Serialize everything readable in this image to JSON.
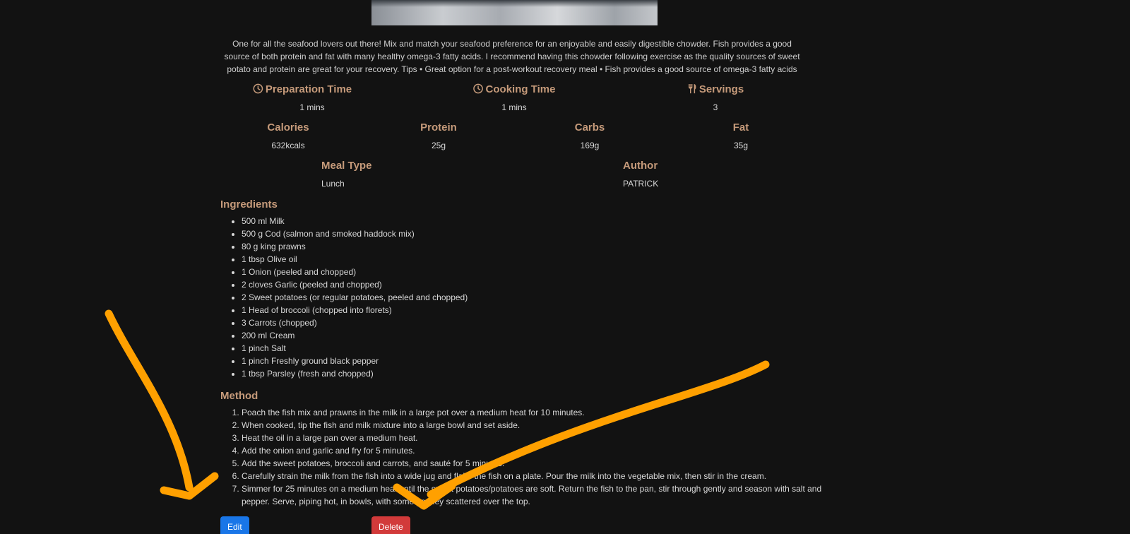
{
  "description": "One for all the seafood lovers out there! Mix and match your seafood preference for an enjoyable and easily digestible chowder. Fish provides a good source of both protein and fat with many healthy omega-3 fatty acids. I recommend having this chowder following exercise as the quality sources of sweet potato and protein are great for your recovery. Tips • Great option for a post-workout recovery meal • Fish provides a good source of omega-3 fatty acids",
  "stats": {
    "prep_label": "Preparation Time",
    "prep_value": "1 mins",
    "cook_label": "Cooking Time",
    "cook_value": "1 mins",
    "servings_label": "Servings",
    "servings_value": "3",
    "calories_label": "Calories",
    "calories_value": "632kcals",
    "protein_label": "Protein",
    "protein_value": "25g",
    "carbs_label": "Carbs",
    "carbs_value": "169g",
    "fat_label": "Fat",
    "fat_value": "35g",
    "meal_type_label": "Meal Type",
    "meal_type_value": "Lunch",
    "author_label": "Author",
    "author_value": "PATRICK"
  },
  "ingredients_title": "Ingredients",
  "ingredients": [
    "500 ml Milk",
    "500 g Cod (salmon and smoked haddock mix)",
    "80 g king prawns",
    "1 tbsp Olive oil",
    "1 Onion (peeled and chopped)",
    "2 cloves Garlic (peeled and chopped)",
    "2 Sweet potatoes (or regular potatoes, peeled and chopped)",
    "1 Head of broccoli (chopped into florets)",
    "3 Carrots (chopped)",
    "200 ml Cream",
    "1 pinch Salt",
    "1 pinch Freshly ground black pepper",
    "1 tbsp Parsley (fresh and chopped)"
  ],
  "method_title": "Method",
  "method": [
    "Poach the fish mix and prawns in the milk in a large pot over a medium heat for 10 minutes.",
    "When cooked, tip the fish and milk mixture into a large bowl and set aside.",
    "Heat the oil in a large pan over a medium heat.",
    "Add the onion and garlic and fry for 5 minutes.",
    "Add the sweet potatoes, broccoli and carrots, and sauté for 5 minutes.",
    "Carefully strain the milk from the fish into a wide jug and flake the fish on a plate. Pour the milk into the vegetable mix, then stir in the cream.",
    "Simmer for 25 minutes on a medium heat until the sweet potatoes/potatoes are soft. Return the fish to the pan, stir through gently and season with salt and pepper. Serve, piping hot, in bowls, with some parsley scattered over the top."
  ],
  "buttons": {
    "edit": "Edit",
    "delete": "Delete"
  },
  "colors": {
    "background": "#121212",
    "heading": "#c59a7a",
    "edit_button": "#1976e8",
    "delete_button": "#d23a3a",
    "annotation": "#ffa000"
  },
  "icons": {
    "prep": "clock-icon",
    "cook": "clock-icon",
    "servings": "utensils-icon"
  }
}
